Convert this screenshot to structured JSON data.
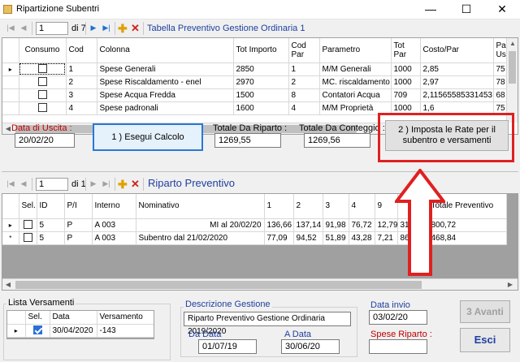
{
  "window": {
    "title": "Ripartizione Subentri",
    "min": "—",
    "max": "☐",
    "close": "✕"
  },
  "nav1": {
    "position": "1",
    "of": "di 7",
    "title": "Tabella Preventivo Gestione Ordinaria 1"
  },
  "grid1": {
    "headers": [
      "Consumo",
      "Cod",
      "Colonna",
      "Tot Importo",
      "Cod Par",
      "Parametro",
      "Tot Par",
      "Costo/Par",
      "Pa Us"
    ],
    "rows": [
      {
        "marker": "▸",
        "consumo": false,
        "cod": "1",
        "colonna": "Spese Generali",
        "tot_importo": "2850",
        "cod_par": "1",
        "parametro": "M/M Generali",
        "tot_par": "1000",
        "costo_par": "2,85",
        "pa_us": "75"
      },
      {
        "marker": "",
        "consumo": false,
        "cod": "2",
        "colonna": "Spese Riscaldamento - enel",
        "tot_importo": "2970",
        "cod_par": "2",
        "parametro": "MC. riscaldamento",
        "tot_par": "1000",
        "costo_par": "2,97",
        "pa_us": "78"
      },
      {
        "marker": "",
        "consumo": false,
        "cod": "3",
        "colonna": "Spese Acqua Fredda",
        "tot_importo": "1500",
        "cod_par": "8",
        "parametro": "Contatori Acqua",
        "tot_par": "709",
        "costo_par": "2,11565585331453",
        "pa_us": "68"
      },
      {
        "marker": "",
        "consumo": false,
        "cod": "4",
        "colonna": "Spese padronali",
        "tot_importo": "1600",
        "cod_par": "4",
        "parametro": "M/M Proprietà",
        "tot_par": "1000",
        "costo_par": "1,6",
        "pa_us": "75"
      }
    ]
  },
  "calc": {
    "data_uscita_label": "Data  di Uscita :",
    "data_uscita": "20/02/20",
    "esegui_label": "1 ) Esegui Calcolo",
    "tot_riparto_label": "Totale Da Riparto :",
    "tot_riparto": "1269,55",
    "tot_conteggio_label": "Totale Da Conteggio :",
    "tot_conteggio": "1269,56",
    "imposta_label_1": "2 ) Imposta le Rate per il",
    "imposta_label_2": "subentro  e versamenti"
  },
  "nav2": {
    "position": "1",
    "of": "di 1",
    "title": "Riparto Preventivo"
  },
  "grid2": {
    "headers": [
      "Sel.",
      "ID",
      "P/I",
      "Interno",
      "Nominativo",
      "1",
      "2",
      "3",
      "4",
      "9",
      "",
      "Totale Preventivo"
    ],
    "rows": [
      {
        "marker": "▸",
        "sel": false,
        "id": "5",
        "pi": "P",
        "interno": "A 003",
        "nominativo": "MI al 20/02/20",
        "c1": "136,66",
        "c2": "137,14",
        "c3": "91,98",
        "c4": "76,72",
        "c9": "12,79",
        "cx": "31,22",
        "tot": "800,72"
      },
      {
        "marker": "*",
        "sel": false,
        "id": "5",
        "pi": "P",
        "interno": "A 003",
        "nominativo": "Subentro dal 21/02/2020",
        "c1": "77,09",
        "c2": "94,52",
        "c3": "51,89",
        "c4": "43,28",
        "c9": "7,21",
        "cx": "86,84",
        "tot": "468,84"
      }
    ]
  },
  "versamenti": {
    "group": "Lista Versamenti",
    "headers": [
      "Sel.",
      "Data",
      "Versamento"
    ],
    "rows": [
      {
        "marker": "▸",
        "sel": true,
        "data": "30/04/2020",
        "versamento": "-143"
      }
    ]
  },
  "gestione": {
    "descr_label": "Descrizione Gestione",
    "descr": "Riparto Preventivo Gestione Ordinaria 2019/2020",
    "da_label": "Da Data",
    "da": "01/07/19",
    "a_label": "A Data",
    "a": "30/06/20"
  },
  "invio": {
    "label": "Data invio",
    "value": "03/02/20"
  },
  "spese": {
    "label": "Spese Riparto :",
    "value": ""
  },
  "buttons": {
    "avanti": "3 Avanti",
    "esci": "Esci"
  },
  "colors": {
    "accent_red": "#e02020",
    "title_blue": "#1f3fa0",
    "label_red": "#c00000",
    "selection_blue": "#2a6fd6"
  }
}
